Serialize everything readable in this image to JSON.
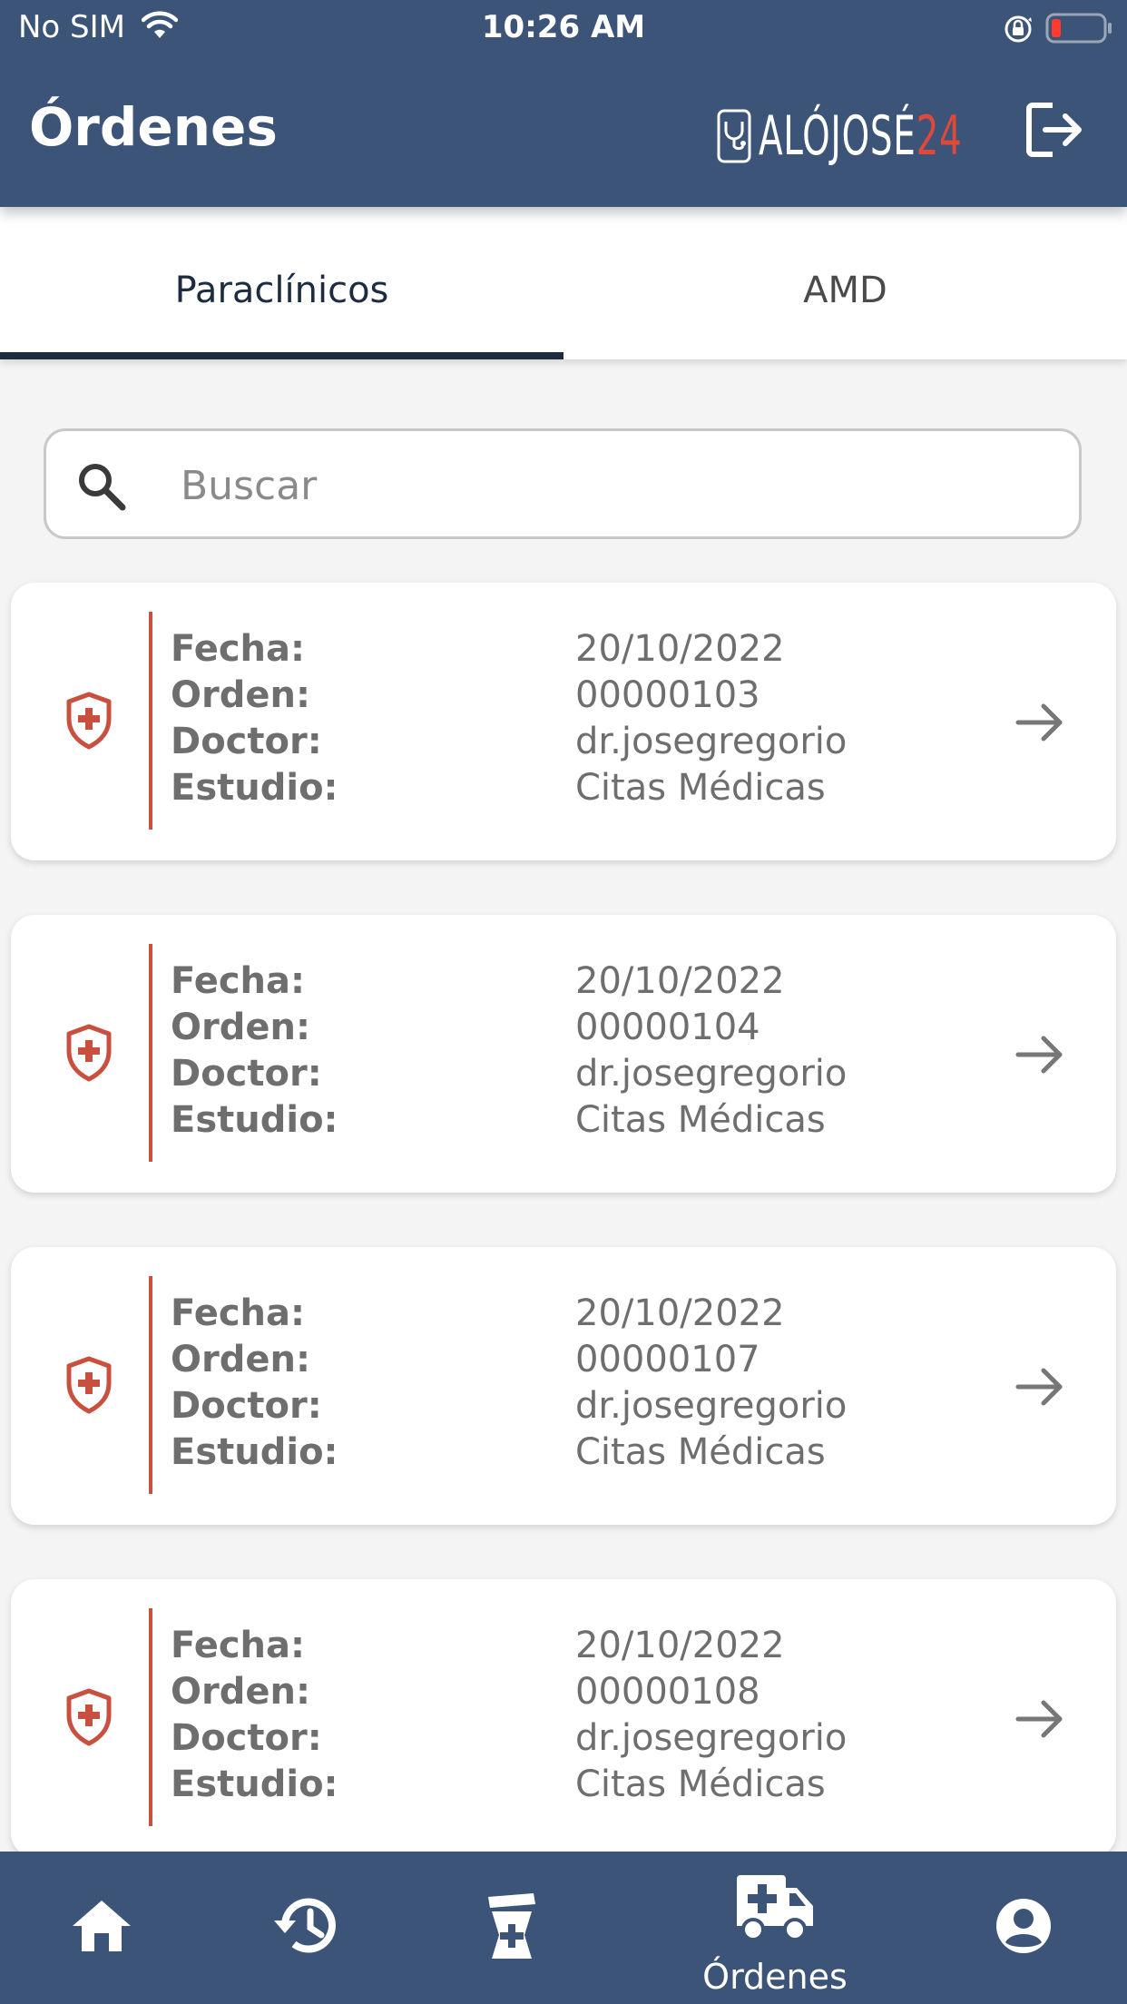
{
  "status_bar": {
    "carrier": "No SIM",
    "time": "10:26 AM"
  },
  "header": {
    "title": "Órdenes",
    "logo_text": "ALÓJOSÉ",
    "logo_number": "24"
  },
  "tabs": [
    {
      "label": "Paraclínicos",
      "selected": true
    },
    {
      "label": "AMD",
      "selected": false
    }
  ],
  "search": {
    "placeholder": "Buscar",
    "value": ""
  },
  "field_labels": {
    "fecha": "Fecha:",
    "orden": "Orden:",
    "doctor": "Doctor:",
    "estudio": "Estudio:"
  },
  "orders": [
    {
      "fecha": "20/10/2022",
      "orden": "00000103",
      "doctor": "dr.josegregorio",
      "estudio": "Citas Médicas"
    },
    {
      "fecha": "20/10/2022",
      "orden": "00000104",
      "doctor": "dr.josegregorio",
      "estudio": "Citas Médicas"
    },
    {
      "fecha": "20/10/2022",
      "orden": "00000107",
      "doctor": "dr.josegregorio",
      "estudio": "Citas Médicas"
    },
    {
      "fecha": "20/10/2022",
      "orden": "00000108",
      "doctor": "dr.josegregorio",
      "estudio": "Citas Médicas"
    }
  ],
  "bottom_nav": [
    {
      "icon": "home-icon",
      "label": ""
    },
    {
      "icon": "history-icon",
      "label": ""
    },
    {
      "icon": "pharmacy-icon",
      "label": ""
    },
    {
      "icon": "ambulance-icon",
      "label": "Órdenes",
      "active": true
    },
    {
      "icon": "account-icon",
      "label": ""
    }
  ],
  "colors": {
    "header_bg": "#3c5478",
    "accent_red": "#c9503e",
    "logo_number": "#e0493a",
    "tab_indicator": "#1e2c40",
    "page_bg": "#f4f4f4"
  }
}
